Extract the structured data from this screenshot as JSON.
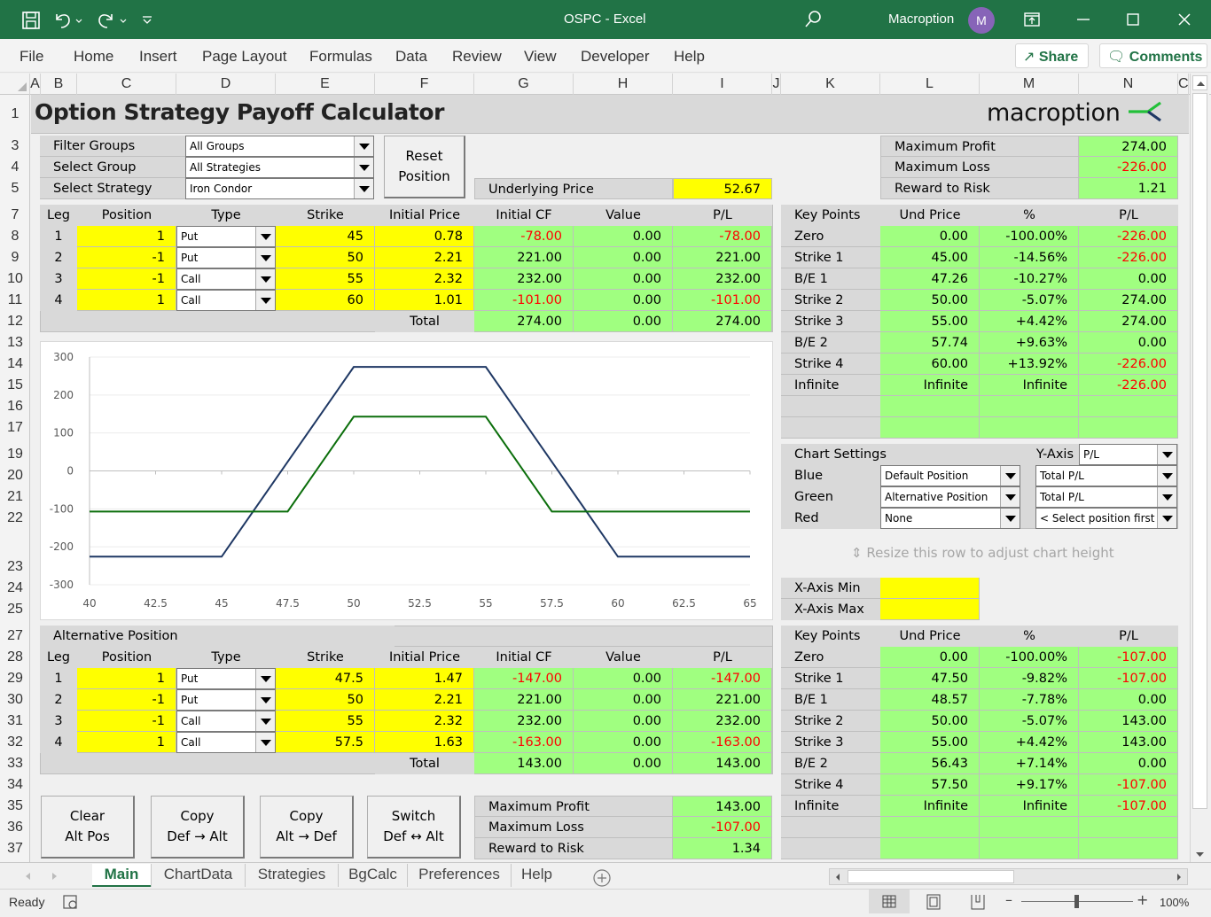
{
  "window": {
    "title": "OSPC  -  Excel",
    "user": "Macroption",
    "avatar_initial": "M",
    "accent": "#217346"
  },
  "ribbon": {
    "menus": [
      "File",
      "Home",
      "Insert",
      "Page Layout",
      "Formulas",
      "Data",
      "Review",
      "View",
      "Developer",
      "Help"
    ],
    "share": "Share",
    "comments": "Comments"
  },
  "columns": [
    "A",
    "B",
    "C",
    "D",
    "E",
    "F",
    "G",
    "H",
    "I",
    "J",
    "K",
    "L",
    "M",
    "N",
    "C"
  ],
  "rows": [
    "1",
    "3",
    "4",
    "5",
    "7",
    "8",
    "9",
    "10",
    "11",
    "12",
    "13",
    "14",
    "15",
    "16",
    "17",
    "19",
    "20",
    "21",
    "22",
    "23",
    "24",
    "25",
    "27",
    "28",
    "29",
    "30",
    "31",
    "32",
    "33",
    "34",
    "35",
    "36",
    "37"
  ],
  "sheet": {
    "title": "Option Strategy Payoff Calculator",
    "logo": "macroption",
    "filters": [
      {
        "label": "Filter Groups",
        "value": "All Groups"
      },
      {
        "label": "Select Group",
        "value": "All Strategies"
      },
      {
        "label": "Select Strategy",
        "value": "Iron Condor"
      }
    ],
    "reset_button": [
      "Reset",
      "Position"
    ],
    "underlying_label": "Underlying Price",
    "underlying_price": "52.67",
    "summary_default": [
      {
        "label": "Maximum Profit",
        "value": "274.00",
        "neg": false
      },
      {
        "label": "Maximum Loss",
        "value": "-226.00",
        "neg": true
      },
      {
        "label": "Reward to Risk",
        "value": "1.21",
        "neg": false
      }
    ],
    "legs_headers": [
      "Leg",
      "Position",
      "Type",
      "Strike",
      "Initial Price",
      "Initial CF",
      "Value",
      "P/L"
    ],
    "default_legs": [
      {
        "leg": "1",
        "position": "1",
        "type": "Put",
        "strike": "45",
        "price": "0.78",
        "cf": "-78.00",
        "value": "0.00",
        "pl": "-78.00"
      },
      {
        "leg": "2",
        "position": "-1",
        "type": "Put",
        "strike": "50",
        "price": "2.21",
        "cf": "221.00",
        "value": "0.00",
        "pl": "221.00"
      },
      {
        "leg": "3",
        "position": "-1",
        "type": "Call",
        "strike": "55",
        "price": "2.32",
        "cf": "232.00",
        "value": "0.00",
        "pl": "232.00"
      },
      {
        "leg": "4",
        "position": "1",
        "type": "Call",
        "strike": "60",
        "price": "1.01",
        "cf": "-101.00",
        "value": "0.00",
        "pl": "-101.00"
      }
    ],
    "default_total": {
      "label": "Total",
      "cf": "274.00",
      "value": "0.00",
      "pl": "274.00"
    },
    "keypoints_headers": [
      "Key Points",
      "Und Price",
      "%",
      "P/L"
    ],
    "default_keypoints": [
      {
        "name": "Zero",
        "price": "0.00",
        "pct": "-100.00%",
        "pl": "-226.00"
      },
      {
        "name": "Strike 1",
        "price": "45.00",
        "pct": "-14.56%",
        "pl": "-226.00"
      },
      {
        "name": "B/E 1",
        "price": "47.26",
        "pct": "-10.27%",
        "pl": "0.00"
      },
      {
        "name": "Strike 2",
        "price": "50.00",
        "pct": "-5.07%",
        "pl": "274.00"
      },
      {
        "name": "Strike 3",
        "price": "55.00",
        "pct": "+4.42%",
        "pl": "274.00"
      },
      {
        "name": "B/E 2",
        "price": "57.74",
        "pct": "+9.63%",
        "pl": "0.00"
      },
      {
        "name": "Strike 4",
        "price": "60.00",
        "pct": "+13.92%",
        "pl": "-226.00"
      },
      {
        "name": "Infinite",
        "price": "Infinite",
        "pct": "Infinite",
        "pl": "-226.00"
      },
      {
        "name": "",
        "price": "",
        "pct": "",
        "pl": ""
      },
      {
        "name": "",
        "price": "",
        "pct": "",
        "pl": ""
      }
    ],
    "chart_settings": {
      "title": "Chart Settings",
      "yaxis_label": "Y-Axis",
      "yaxis_value": "P/L",
      "rows": [
        {
          "label": "Blue",
          "position": "Default Position",
          "metric": "Total P/L"
        },
        {
          "label": "Green",
          "position": "Alternative Position",
          "metric": "Total P/L"
        },
        {
          "label": "Red",
          "position": "None",
          "metric": "< Select position first"
        }
      ],
      "resize_hint": "Resize this row to adjust chart height",
      "xmin_label": "X-Axis Min",
      "xmax_label": "X-Axis Max",
      "xmin_value": "",
      "xmax_value": ""
    },
    "alt_title": "Alternative Position",
    "alt_legs": [
      {
        "leg": "1",
        "position": "1",
        "type": "Put",
        "strike": "47.5",
        "price": "1.47",
        "cf": "-147.00",
        "value": "0.00",
        "pl": "-147.00"
      },
      {
        "leg": "2",
        "position": "-1",
        "type": "Put",
        "strike": "50",
        "price": "2.21",
        "cf": "221.00",
        "value": "0.00",
        "pl": "221.00"
      },
      {
        "leg": "3",
        "position": "-1",
        "type": "Call",
        "strike": "55",
        "price": "2.32",
        "cf": "232.00",
        "value": "0.00",
        "pl": "232.00"
      },
      {
        "leg": "4",
        "position": "1",
        "type": "Call",
        "strike": "57.5",
        "price": "1.63",
        "cf": "-163.00",
        "value": "0.00",
        "pl": "-163.00"
      }
    ],
    "alt_total": {
      "label": "Total",
      "cf": "143.00",
      "value": "0.00",
      "pl": "143.00"
    },
    "alt_keypoints": [
      {
        "name": "Zero",
        "price": "0.00",
        "pct": "-100.00%",
        "pl": "-107.00"
      },
      {
        "name": "Strike 1",
        "price": "47.50",
        "pct": "-9.82%",
        "pl": "-107.00"
      },
      {
        "name": "B/E 1",
        "price": "48.57",
        "pct": "-7.78%",
        "pl": "0.00"
      },
      {
        "name": "Strike 2",
        "price": "50.00",
        "pct": "-5.07%",
        "pl": "143.00"
      },
      {
        "name": "Strike 3",
        "price": "55.00",
        "pct": "+4.42%",
        "pl": "143.00"
      },
      {
        "name": "B/E 2",
        "price": "56.43",
        "pct": "+7.14%",
        "pl": "0.00"
      },
      {
        "name": "Strike 4",
        "price": "57.50",
        "pct": "+9.17%",
        "pl": "-107.00"
      },
      {
        "name": "Infinite",
        "price": "Infinite",
        "pct": "Infinite",
        "pl": "-107.00"
      },
      {
        "name": "",
        "price": "",
        "pct": "",
        "pl": ""
      },
      {
        "name": "",
        "price": "",
        "pct": "",
        "pl": ""
      }
    ],
    "alt_buttons": [
      [
        "Clear",
        "Alt Pos"
      ],
      [
        "Copy",
        "Def → Alt"
      ],
      [
        "Copy",
        "Alt → Def"
      ],
      [
        "Switch",
        "Def ↔ Alt"
      ]
    ],
    "summary_alt": [
      {
        "label": "Maximum Profit",
        "value": "143.00",
        "neg": false
      },
      {
        "label": "Maximum Loss",
        "value": "-107.00",
        "neg": true
      },
      {
        "label": "Reward to Risk",
        "value": "1.34",
        "neg": false
      }
    ]
  },
  "chart_data": {
    "type": "line",
    "title": "",
    "xlabel": "",
    "ylabel": "",
    "xlim": [
      40,
      65
    ],
    "ylim": [
      -300,
      300
    ],
    "xticks": [
      "40",
      "42.5",
      "45",
      "47.5",
      "50",
      "52.5",
      "55",
      "57.5",
      "60",
      "62.5",
      "65"
    ],
    "yticks": [
      "300",
      "200",
      "100",
      "0",
      "-100",
      "-200",
      "-300"
    ],
    "grid": true,
    "legend": "none",
    "series": [
      {
        "name": "Default Position",
        "color": "#1f3864",
        "x": [
          40,
          45,
          50,
          55,
          60,
          65
        ],
        "y": [
          -226,
          -226,
          274,
          274,
          -226,
          -226
        ]
      },
      {
        "name": "Alternative Position",
        "color": "#0b6e0b",
        "x": [
          40,
          47.5,
          50,
          55,
          57.5,
          65
        ],
        "y": [
          -107,
          -107,
          143,
          143,
          -107,
          -107
        ]
      }
    ]
  },
  "tabs": [
    "Main",
    "ChartData",
    "Strategies",
    "BgCalc",
    "Preferences",
    "Help"
  ],
  "active_tab": "Main",
  "status": {
    "ready": "Ready",
    "zoom": "100%"
  }
}
